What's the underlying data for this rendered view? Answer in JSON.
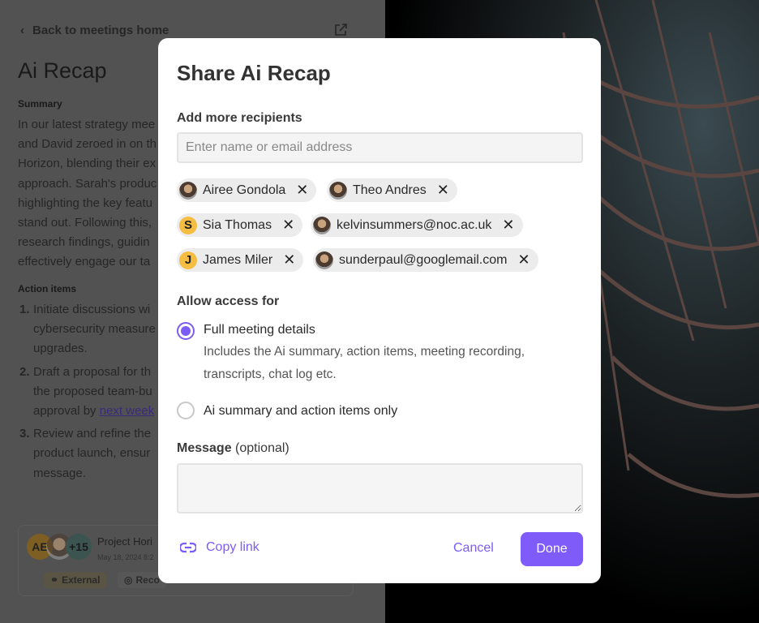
{
  "background": {
    "back_label": "Back to meetings home",
    "title": "Ai Recap",
    "summary_heading": "Summary",
    "summary_lines": [
      "In our latest strategy mee",
      "and David zeroed in on th",
      "Horizon, blending their ex",
      "approach. Sarah's produc",
      "highlighting the key featu",
      "stand out. Following this,",
      "research findings, guidin",
      "effectively engage our ta"
    ],
    "action_heading": "Action items",
    "actions": [
      {
        "num": "1.",
        "lines": [
          "Initiate discussions wi",
          "cybersecurity measure",
          "upgrades."
        ]
      },
      {
        "num": "2.",
        "lines": [
          "Draft a proposal for th",
          "the proposed team-bu"
        ],
        "last_prefix": "approval by ",
        "link": "next week"
      },
      {
        "num": "3.",
        "lines": [
          "Review and refine the",
          "product launch, ensur",
          "message."
        ]
      }
    ],
    "card": {
      "avatar_initials": "AE",
      "more_count": "+15",
      "title": "Project Hori",
      "date": "May 18, 2024 8:2",
      "tags": [
        "External",
        "Reco"
      ]
    }
  },
  "dialog": {
    "title": "Share Ai Recap",
    "recipients_label": "Add more recipients",
    "recipients_placeholder": "Enter name or email address",
    "chips": [
      {
        "name": "Airee Gondola",
        "avatar": "photo"
      },
      {
        "name": "Theo Andres",
        "avatar": "photo"
      },
      {
        "name": "Sia Thomas",
        "avatar": "S"
      },
      {
        "name": "kelvinsummers@noc.ac.uk",
        "avatar": "photo"
      },
      {
        "name": "James Miler",
        "avatar": "J"
      },
      {
        "name": "sunderpaul@googlemail.com",
        "avatar": "photo"
      }
    ],
    "access_label": "Allow access for",
    "options": [
      {
        "label": "Full meeting details",
        "selected": true,
        "description": "Includes the Ai summary, action items, meeting recording, transcripts, chat log etc."
      },
      {
        "label": "Ai summary and action items only",
        "selected": false
      }
    ],
    "message_label": "Message",
    "message_optional": "(optional)",
    "message_value": "",
    "copy_link": "Copy link",
    "cancel": "Cancel",
    "done": "Done"
  },
  "colors": {
    "accent": "#7f5cfa",
    "initial_avatar": "#f5bd41",
    "overlay": "#525252"
  }
}
